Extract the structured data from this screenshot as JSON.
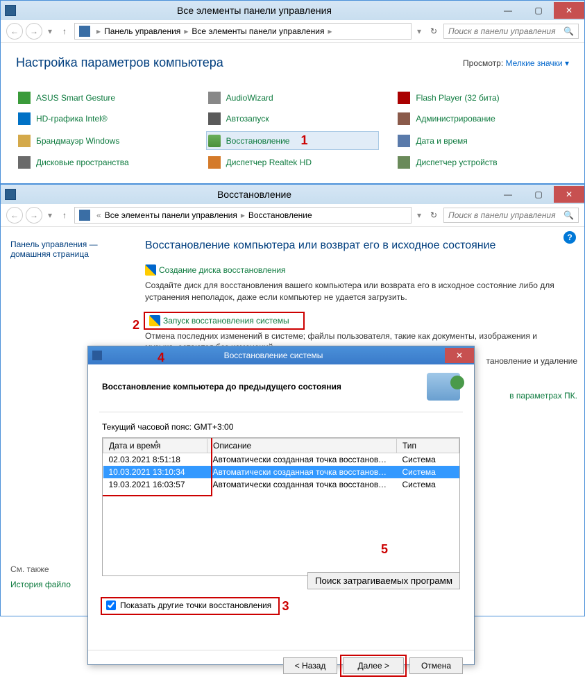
{
  "window1": {
    "title": "Все элементы панели управления",
    "breadcrumb": {
      "root": "Панель управления",
      "current": "Все элементы панели управления"
    },
    "search_placeholder": "Поиск в панели управления",
    "heading": "Настройка параметров компьютера",
    "view_label": "Просмотр:",
    "view_value": "Мелкие значки",
    "items": [
      {
        "label": "ASUS Smart Gesture",
        "icon": "asus"
      },
      {
        "label": "AudioWizard",
        "icon": "audio"
      },
      {
        "label": "Flash Player (32 бита)",
        "icon": "flash"
      },
      {
        "label": "HD-графика Intel®",
        "icon": "intel"
      },
      {
        "label": "Автозапуск",
        "icon": "autorun"
      },
      {
        "label": "Администрирование",
        "icon": "admin"
      },
      {
        "label": "Брандмауэр Windows",
        "icon": "firewall"
      },
      {
        "label": "Восстановление",
        "icon": "recovery",
        "highlight": true
      },
      {
        "label": "Дата и время",
        "icon": "date"
      },
      {
        "label": "Дисковые пространства",
        "icon": "disk"
      },
      {
        "label": "Диспетчер Realtek HD",
        "icon": "realtek"
      },
      {
        "label": "Диспетчер устройств",
        "icon": "device"
      }
    ]
  },
  "window2": {
    "title": "Восстановление",
    "breadcrumb": {
      "root": "Все элементы панели управления",
      "current": "Восстановление"
    },
    "search_placeholder": "Поиск в панели управления",
    "sidebar": {
      "home": "Панель управления — домашняя страница",
      "see_also": "См. также",
      "link": "История файло"
    },
    "main": {
      "title": "Восстановление компьютера или возврат его в исходное состояние",
      "sec1_link": "Создание диска восстановления",
      "sec1_desc": "Создайте диск для восстановления вашего компьютера или возврата его в исходное состояние либо для устранения неполадок, даже если компьютер не удается загрузить.",
      "sec2_link": "Запуск восстановления системы",
      "sec2_desc": "Отмена последних изменений в системе; файлы пользователя, такие как документы, изображения и музыка, остаются без изменений.",
      "partial1": "тановление и удаление",
      "partial2": "в параметрах ПК."
    }
  },
  "dialog": {
    "title": "Восстановление системы",
    "heading": "Восстановление компьютера до предыдущего состояния",
    "timezone": "Текущий часовой пояс: GMT+3:00",
    "cols": {
      "date": "Дата и время",
      "desc": "Описание",
      "type": "Тип"
    },
    "rows": [
      {
        "date": "02.03.2021 8:51:18",
        "desc": "Автоматически созданная точка восстановле...",
        "type": "Система",
        "selected": false
      },
      {
        "date": "10.03.2021 13:10:34",
        "desc": "Автоматически созданная точка восстановле...",
        "type": "Система",
        "selected": true
      },
      {
        "date": "19.03.2021 16:03:57",
        "desc": "Автоматически созданная точка восстановле...",
        "type": "Система",
        "selected": false
      }
    ],
    "checkbox": "Показать другие точки восстановления",
    "scan_btn": "Поиск затрагиваемых программ",
    "back": "< Назад",
    "next": "Далее >",
    "cancel": "Отмена"
  },
  "annotations": {
    "a1": "1",
    "a2": "2",
    "a3": "3",
    "a4": "4",
    "a5": "5"
  }
}
